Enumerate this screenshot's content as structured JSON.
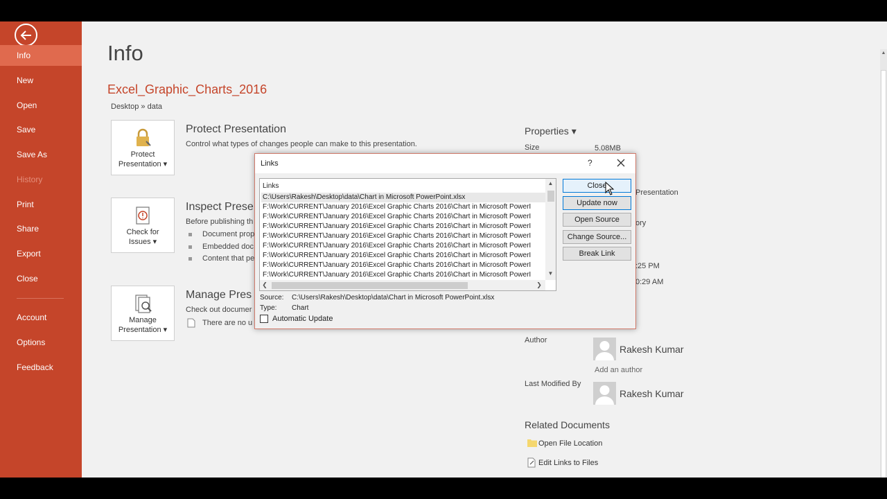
{
  "nav": {
    "items": [
      {
        "label": "Info",
        "state": "active"
      },
      {
        "label": "New"
      },
      {
        "label": "Open"
      },
      {
        "label": "Save"
      },
      {
        "label": "Save As"
      },
      {
        "label": "History",
        "state": "disabled"
      },
      {
        "label": "Print"
      },
      {
        "label": "Share"
      },
      {
        "label": "Export"
      },
      {
        "label": "Close"
      },
      {
        "label": "Account"
      },
      {
        "label": "Options"
      },
      {
        "label": "Feedback"
      }
    ],
    "accent": "#c5452a"
  },
  "main": {
    "title": "Info",
    "file_name": "Excel_Graphic_Charts_2016",
    "path": "Desktop » data",
    "protect": {
      "tile_line1": "Protect",
      "tile_line2": "Presentation ▾",
      "title": "Protect Presentation",
      "desc": "Control what types of changes people can make to this presentation."
    },
    "inspect": {
      "tile_line1": "Check for",
      "tile_line2": "Issues ▾",
      "title": "Inspect Prese",
      "desc": "Before publishing th",
      "bullets": [
        "Document prop",
        "Embedded doc",
        "Content that pe"
      ]
    },
    "manage": {
      "tile_line1": "Manage",
      "tile_line2": "Presentation ▾",
      "title": "Manage Pres",
      "desc": "Check out documer",
      "note": "There are no u"
    }
  },
  "properties": {
    "header": "Properties ▾",
    "size_label": "Size",
    "size_value": "5.08MB",
    "frag1": "Presentation",
    "frag2": "ory",
    "frag3": ":25 PM",
    "frag4": "0:29 AM",
    "author_label": "Author",
    "author_name": "Rakesh Kumar",
    "add_author": "Add an author",
    "modified_label": "Last Modified By",
    "modified_name": "Rakesh Kumar",
    "related_header": "Related Documents",
    "open_location": "Open File Location",
    "edit_links": "Edit Links to Files"
  },
  "dialog": {
    "title": "Links",
    "help": "?",
    "list_header": "Links",
    "rows": [
      "C:\\Users\\Rakesh\\Desktop\\data\\Chart in Microsoft PowerPoint.xlsx",
      "F:\\Work\\CURRENT\\January 2016\\Excel Graphic Charts 2016\\Chart in Microsoft PowerI",
      "F:\\Work\\CURRENT\\January 2016\\Excel Graphic Charts 2016\\Chart in Microsoft PowerI",
      "F:\\Work\\CURRENT\\January 2016\\Excel Graphic Charts 2016\\Chart in Microsoft PowerI",
      "F:\\Work\\CURRENT\\January 2016\\Excel Graphic Charts 2016\\Chart in Microsoft PowerI",
      "F:\\Work\\CURRENT\\January 2016\\Excel Graphic Charts 2016\\Chart in Microsoft PowerI",
      "F:\\Work\\CURRENT\\January 2016\\Excel Graphic Charts 2016\\Chart in Microsoft PowerI",
      "F:\\Work\\CURRENT\\January 2016\\Excel Graphic Charts 2016\\Chart in Microsoft PowerI",
      "F:\\Work\\CURRENT\\January 2016\\Excel Graphic Charts 2016\\Chart in Microsoft PowerI"
    ],
    "buttons": {
      "close": "Close",
      "update_now": "Update now",
      "open_source": "Open Source",
      "change_source": "Change Source...",
      "break_link": "Break Link"
    },
    "source_label": "Source:",
    "source_value": "C:\\Users\\Rakesh\\Desktop\\data\\Chart in Microsoft PowerPoint.xlsx",
    "type_label": "Type:",
    "type_value": "Chart",
    "auto_update": "Automatic Update",
    "auto_update_checked": false
  }
}
